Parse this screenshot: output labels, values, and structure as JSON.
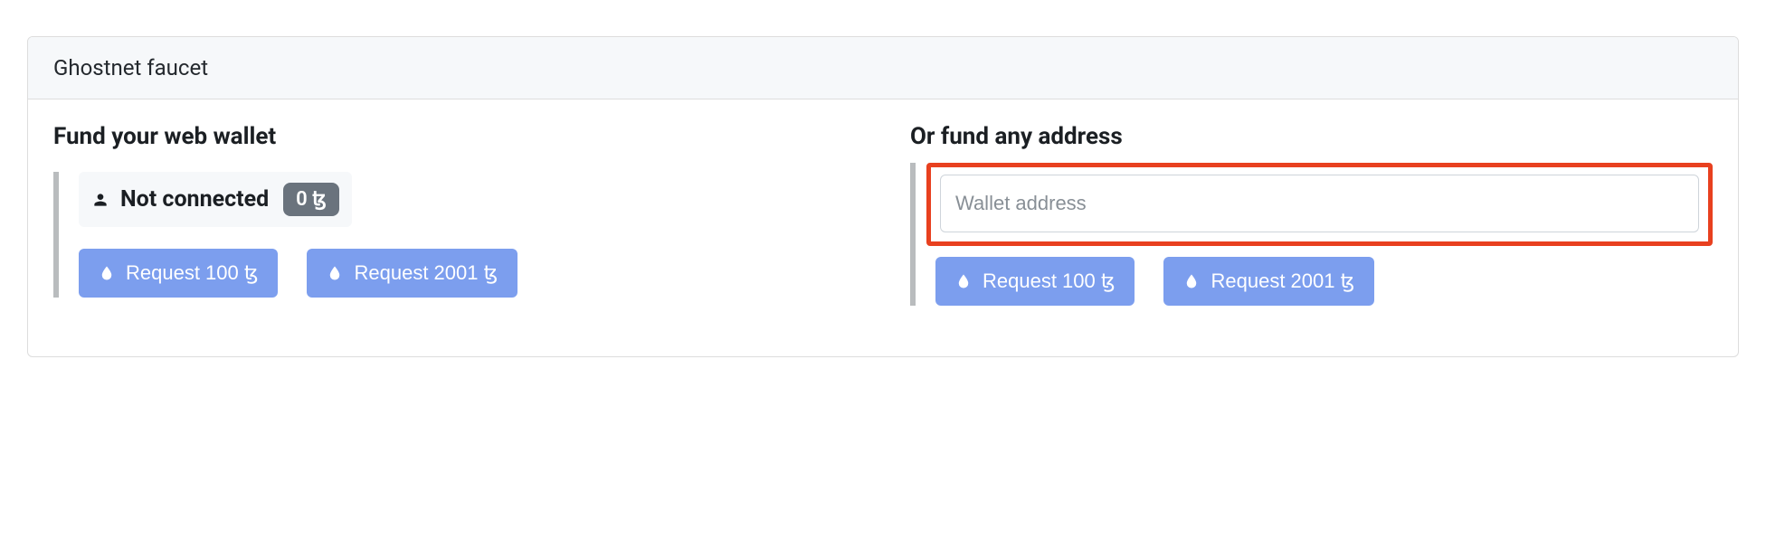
{
  "card": {
    "title": "Ghostnet faucet"
  },
  "leftColumn": {
    "title": "Fund your web wallet",
    "status": "Not connected",
    "balance": "0 ꜩ",
    "buttons": [
      {
        "label": "Request 100 ꜩ"
      },
      {
        "label": "Request 2001 ꜩ"
      }
    ]
  },
  "rightColumn": {
    "title": "Or fund any address",
    "inputPlaceholder": "Wallet address",
    "buttons": [
      {
        "label": "Request 100 ꜩ"
      },
      {
        "label": "Request 2001 ꜩ"
      }
    ]
  }
}
